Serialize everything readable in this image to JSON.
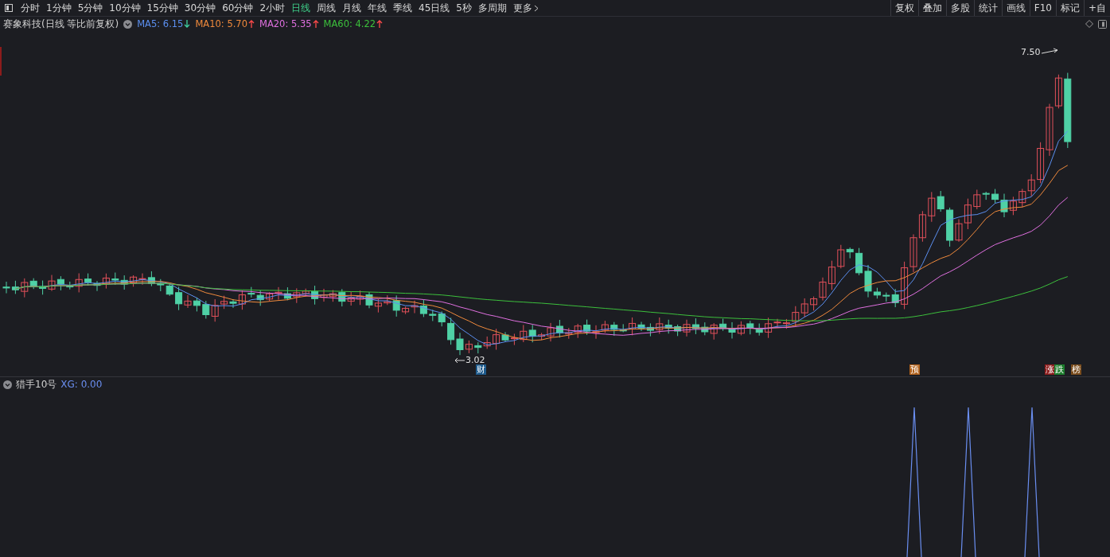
{
  "toolbar": {
    "periods": [
      {
        "label": "分时",
        "selected": false
      },
      {
        "label": "1分钟",
        "selected": false
      },
      {
        "label": "5分钟",
        "selected": false
      },
      {
        "label": "10分钟",
        "selected": false
      },
      {
        "label": "15分钟",
        "selected": false
      },
      {
        "label": "30分钟",
        "selected": false
      },
      {
        "label": "60分钟",
        "selected": false
      },
      {
        "label": "2小时",
        "selected": false
      },
      {
        "label": "日线",
        "selected": true
      },
      {
        "label": "周线",
        "selected": false
      },
      {
        "label": "月线",
        "selected": false
      },
      {
        "label": "年线",
        "selected": false
      },
      {
        "label": "季线",
        "selected": false
      },
      {
        "label": "45日线",
        "selected": false
      },
      {
        "label": "5秒",
        "selected": false
      },
      {
        "label": "多周期",
        "selected": false
      }
    ],
    "more": "更多",
    "buttons": [
      "复权",
      "叠加",
      "多股",
      "统计",
      "画线",
      "F10",
      "标记",
      "+自"
    ]
  },
  "legend": {
    "title": "赛象科技(日线 等比前复权)",
    "ma": [
      {
        "label": "MA5: 6.15",
        "color": "#5b8ff0",
        "rising": false
      },
      {
        "label": "MA10: 5.70",
        "color": "#f08a3c",
        "rising": true
      },
      {
        "label": "MA20: 5.35",
        "color": "#e070e0",
        "rising": true
      },
      {
        "label": "MA60: 4.22",
        "color": "#3cc03c",
        "rising": true
      }
    ]
  },
  "chart": {
    "high_label": "7.50",
    "low_label": "3.02",
    "badges": [
      {
        "text": "财",
        "color": "#1d5a8c"
      },
      {
        "text": "预",
        "color": "#b0601a"
      },
      {
        "text": "涨",
        "color": "#8c1c1c"
      },
      {
        "text": "跌",
        "color": "#1c7c2c"
      },
      {
        "text": "榜",
        "color": "#7a4c1c"
      }
    ]
  },
  "indicator": {
    "name": "猎手10号",
    "reading": "XG: 0.00"
  }
}
